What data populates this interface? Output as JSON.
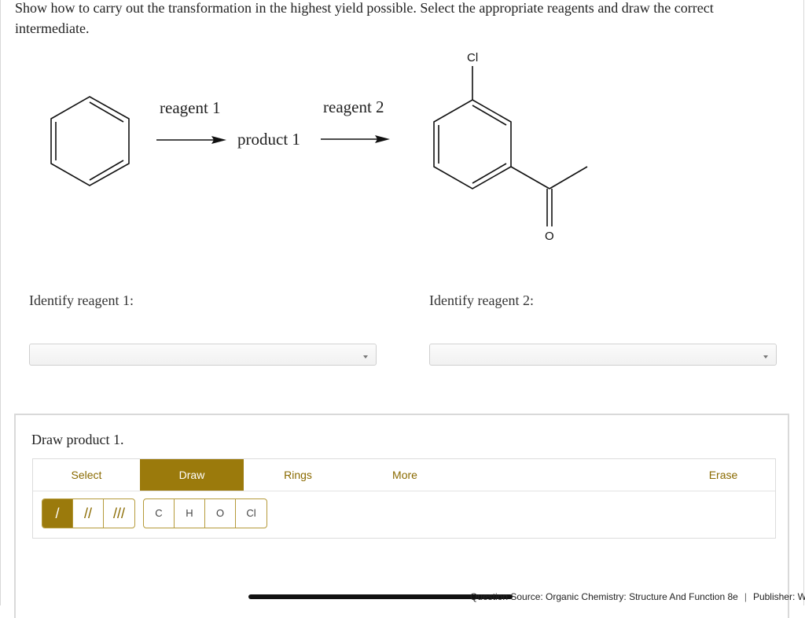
{
  "question": {
    "text": "Show how to carry out the transformation in the highest yield possible. Select the appropriate reagents and draw the correct intermediate."
  },
  "scheme": {
    "reagent1_label": "reagent 1",
    "product1_label": "product 1",
    "reagent2_label": "reagent 2",
    "atom_cl": "Cl",
    "atom_o": "O"
  },
  "identify": {
    "reagent1_prompt": "Identify reagent 1:",
    "reagent1_value": "",
    "reagent2_prompt": "Identify reagent 2:",
    "reagent2_value": ""
  },
  "draw_panel": {
    "title": "Draw product 1.",
    "tabs": {
      "select": "Select",
      "draw": "Draw",
      "rings": "Rings",
      "more": "More",
      "erase": "Erase"
    },
    "active_tab": "Draw",
    "bond_buttons": [
      "/",
      "//",
      "///"
    ],
    "atom_buttons": [
      "C",
      "H",
      "O",
      "Cl"
    ]
  },
  "footer": {
    "source": "Question Source: Organic Chemistry: Structure And Function 8e",
    "publisher": "Publisher: W"
  },
  "colors": {
    "accent": "#9b7a0c",
    "accent_text": "#8a6a00"
  }
}
